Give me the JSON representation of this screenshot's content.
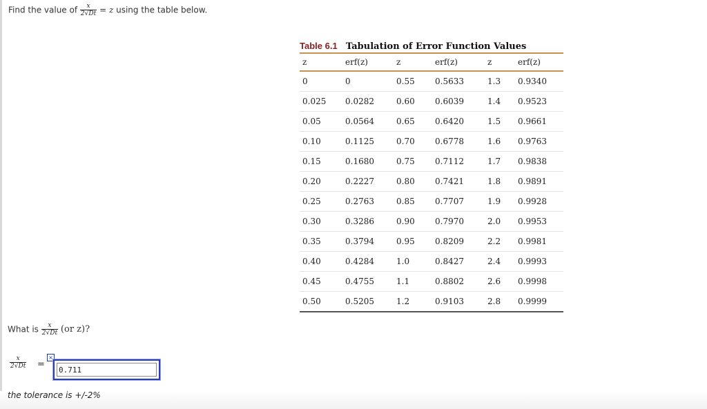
{
  "question1": {
    "prefix": "Find the value of",
    "frac_num": "x",
    "frac_den_coef": "2",
    "frac_den_rad": "Dt",
    "equals": "=",
    "var": "z",
    "suffix": "using the table below."
  },
  "table": {
    "label": "Table 6.1",
    "title": "Tabulation of Error Function Values",
    "headers": [
      "z",
      "erf(z)",
      "z",
      "erf(z)",
      "z",
      "erf(z)"
    ],
    "rows": [
      [
        "0",
        "0",
        "0.55",
        "0.5633",
        "1.3",
        "0.9340"
      ],
      [
        "0.025",
        "0.0282",
        "0.60",
        "0.6039",
        "1.4",
        "0.9523"
      ],
      [
        "0.05",
        "0.0564",
        "0.65",
        "0.6420",
        "1.5",
        "0.9661"
      ],
      [
        "0.10",
        "0.1125",
        "0.70",
        "0.6778",
        "1.6",
        "0.9763"
      ],
      [
        "0.15",
        "0.1680",
        "0.75",
        "0.7112",
        "1.7",
        "0.9838"
      ],
      [
        "0.20",
        "0.2227",
        "0.80",
        "0.7421",
        "1.8",
        "0.9891"
      ],
      [
        "0.25",
        "0.2763",
        "0.85",
        "0.7707",
        "1.9",
        "0.9928"
      ],
      [
        "0.30",
        "0.3286",
        "0.90",
        "0.7970",
        "2.0",
        "0.9953"
      ],
      [
        "0.35",
        "0.3794",
        "0.95",
        "0.8209",
        "2.2",
        "0.9981"
      ],
      [
        "0.40",
        "0.4284",
        "1.0",
        "0.8427",
        "2.4",
        "0.9993"
      ],
      [
        "0.45",
        "0.4755",
        "1.1",
        "0.8802",
        "2.6",
        "0.9998"
      ],
      [
        "0.50",
        "0.5205",
        "1.2",
        "0.9103",
        "2.8",
        "0.9999"
      ]
    ]
  },
  "question2": {
    "prefix": "What is",
    "frac_num": "x",
    "frac_den_coef": "2",
    "frac_den_rad": "Dt",
    "suffix": "(or z)?"
  },
  "answer": {
    "frac_num": "x",
    "frac_den_coef": "2",
    "frac_den_rad": "Dt",
    "equals": "=",
    "status_icon": "incorrect-x-icon",
    "status_glyph": "×",
    "value": "0.711"
  },
  "tolerance_note": "the tolerance is +/-2%",
  "colors": {
    "caption_label": "#8b1f1f",
    "table_rule": "#c8924e",
    "input_border": "#2a3db5"
  }
}
